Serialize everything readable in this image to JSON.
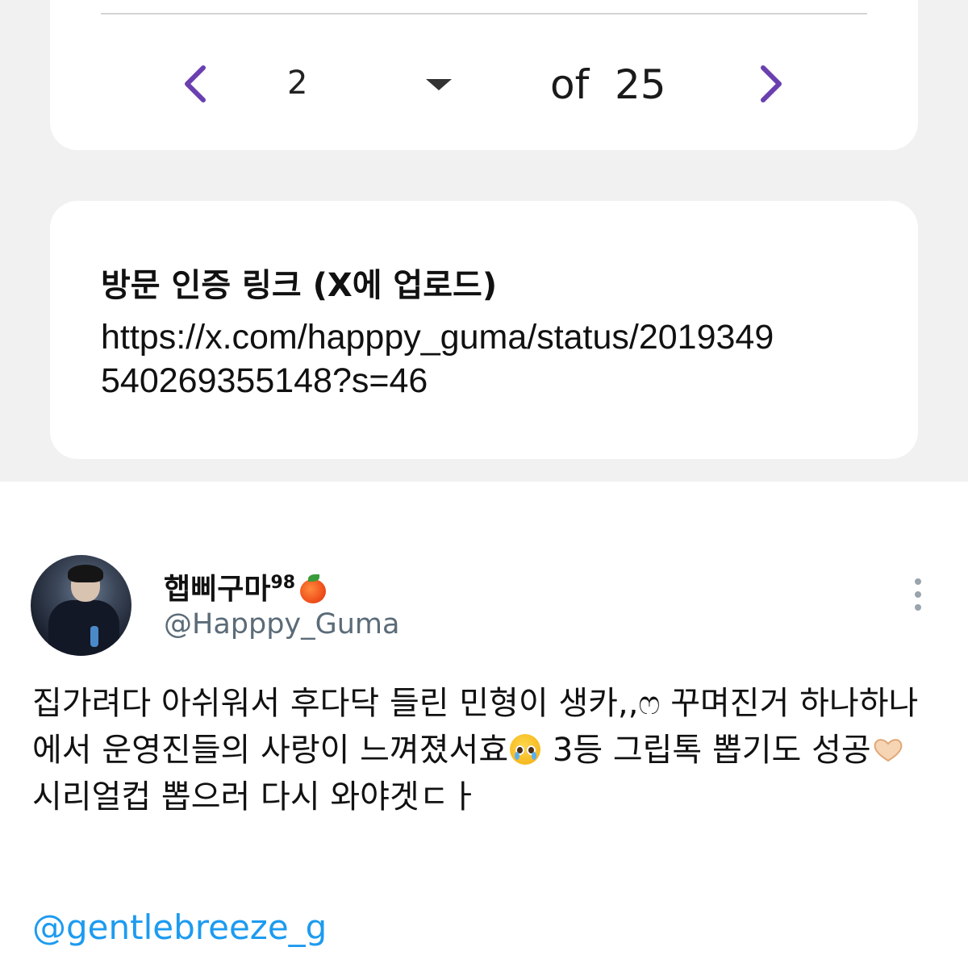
{
  "pager": {
    "current_page": "2",
    "of_text": "of  25",
    "prev_icon": "chevron-left-icon",
    "next_icon": "chevron-right-icon",
    "accent_color": "#6a3fb0"
  },
  "link_card": {
    "title": "방문 인증 링크 (X에 업로드)",
    "url": "https://x.com/happpy_guma/status/2019349540269355148?s=46"
  },
  "tweet": {
    "display_name": "햅삐구마",
    "display_name_suffix": "98",
    "name_emoji": "peach-icon",
    "handle": "@Happpy_Guma",
    "text_part1": "집가려다 아쉬워서 후다닥 들린 민형이 생카,,ෆ 꾸며진거 하나하나에서 운영진들의 사랑이 느껴졌서효",
    "text_part2": " 3등 그립톡 뽑기도 성공",
    "text_part3": " 시리얼컵 뽑으러 다시 와야겟ㄷㅏ",
    "mention": "@gentlebreeze_g",
    "mention_color": "#1d9bf0"
  }
}
